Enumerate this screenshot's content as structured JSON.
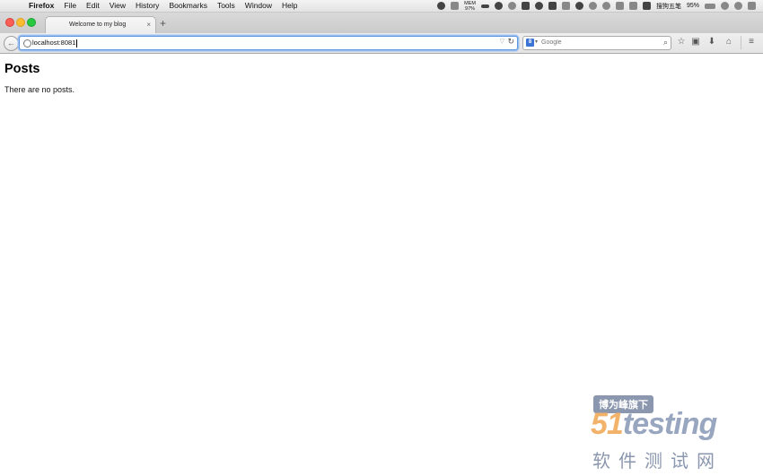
{
  "menubar": {
    "apple_icon": "apple-icon",
    "app_name": "Firefox",
    "items": [
      "File",
      "Edit",
      "View",
      "History",
      "Bookmarks",
      "Tools",
      "Window",
      "Help"
    ],
    "status": {
      "mem_label": "MEM",
      "mem_value": "97%",
      "ime_label": "搜狗五笔",
      "battery": "95%"
    }
  },
  "tab": {
    "title": "Welcome to my blog",
    "close": "×",
    "new_tab": "+"
  },
  "navbar": {
    "url": "localhost:8081",
    "search_placeholder": "Google",
    "search_engine_letter": "8"
  },
  "page": {
    "heading": "Posts",
    "message": "There are no posts."
  },
  "watermark": {
    "tag": "博为峰旗下",
    "brand_num": "51",
    "brand_word": "testing",
    "sub": "软件测试网"
  }
}
